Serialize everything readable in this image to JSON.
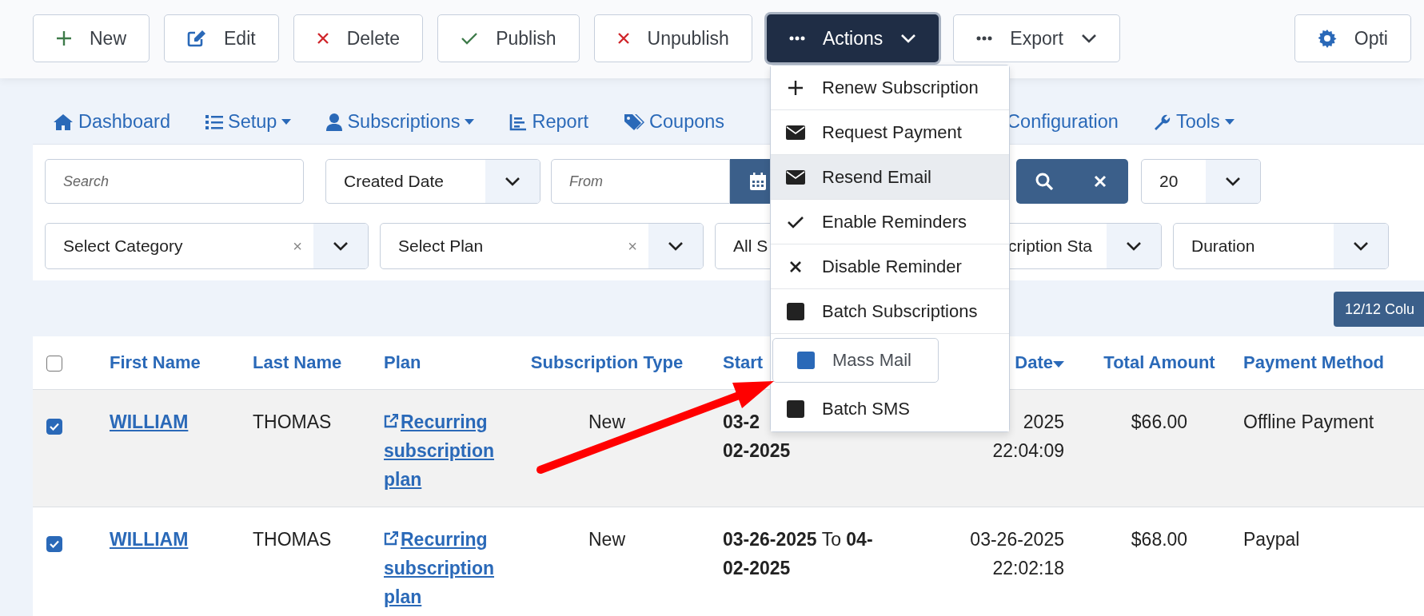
{
  "toolbar": {
    "buttons": [
      {
        "label": "New",
        "kind": "new"
      },
      {
        "label": "Edit",
        "kind": "edit"
      },
      {
        "label": "Delete",
        "kind": "delete"
      },
      {
        "label": "Publish",
        "kind": "publish"
      },
      {
        "label": "Unpublish",
        "kind": "unpublish"
      },
      {
        "label": "Actions",
        "kind": "dropdown",
        "expanded": true
      },
      {
        "label": "Export",
        "kind": "dropdown",
        "expanded": false
      },
      {
        "label": "Opti",
        "kind": "options"
      }
    ]
  },
  "actions_menu": {
    "items": [
      {
        "label": "Renew Subscription",
        "kind": "plus",
        "hovered": false,
        "selected": false
      },
      {
        "label": "Request Payment",
        "kind": "envelope",
        "hovered": false,
        "selected": false
      },
      {
        "label": "Resend Email",
        "kind": "envelope",
        "hovered": true,
        "selected": false
      },
      {
        "label": "Enable Reminders",
        "kind": "check",
        "hovered": false,
        "selected": false
      },
      {
        "label": "Disable Reminder",
        "kind": "cross",
        "hovered": false,
        "selected": false
      },
      {
        "label": "Batch Subscriptions",
        "kind": "square",
        "hovered": false,
        "selected": false
      },
      {
        "label": "Mass Mail",
        "kind": "square",
        "hovered": false,
        "selected": true
      },
      {
        "label": "Batch SMS",
        "kind": "square",
        "hovered": false,
        "selected": false
      }
    ]
  },
  "nav": [
    {
      "label": "Dashboard",
      "has_menu": false
    },
    {
      "label": "Setup",
      "has_menu": true
    },
    {
      "label": "Subscriptions",
      "has_menu": true
    },
    {
      "label": "Report",
      "has_menu": false
    },
    {
      "label": "Coupons",
      "has_menu": false
    },
    {
      "label": "Configuration",
      "has_menu": false
    },
    {
      "label": "Tools",
      "has_menu": true
    }
  ],
  "filters": {
    "search": {
      "placeholder": "Search"
    },
    "date_field": "Created Date",
    "from": {
      "placeholder": "From"
    },
    "per_page": "20",
    "selects": [
      {
        "value": "Select Category",
        "clear": "×"
      },
      {
        "value": "Select Plan",
        "clear": "×"
      },
      {
        "value": "All S"
      },
      {
        "value": "cription Sta"
      },
      {
        "value": "Duration"
      }
    ]
  },
  "columns_button": "12/12 Colu",
  "table": {
    "select_all": false,
    "columns": [
      {
        "label": "First Name",
        "sorted": false
      },
      {
        "label": "Last Name",
        "sorted": false
      },
      {
        "label": "Plan",
        "sorted": false
      },
      {
        "label": "Subscription Type",
        "sorted": false
      },
      {
        "label": "Start",
        "sorted": false
      },
      {
        "label": "Date",
        "sorted": true
      },
      {
        "label": "Total Amount",
        "sorted": false
      },
      {
        "label": "Payment Method",
        "sorted": false
      }
    ],
    "rows": [
      {
        "selected": true,
        "hovered": true,
        "first_name": "WILLIAM",
        "last_name": "THOMAS",
        "plan": "Recurring subscription plan",
        "subscription_type": "New",
        "start": [
          "**03-2**",
          "**02-2025**"
        ],
        "created": [
          "2025",
          "22:04:09"
        ],
        "total": "$66.00",
        "payment_method": "Offline Payment"
      },
      {
        "selected": true,
        "hovered": false,
        "first_name": "WILLIAM",
        "last_name": "THOMAS",
        "plan": "Recurring subscription plan",
        "subscription_type": "New",
        "start": [
          "**03-26-2025** To **04-**",
          "**02-2025**"
        ],
        "created": [
          "03-26-2025",
          "22:02:18"
        ],
        "total": "$68.00",
        "payment_method": "Paypal"
      }
    ]
  }
}
